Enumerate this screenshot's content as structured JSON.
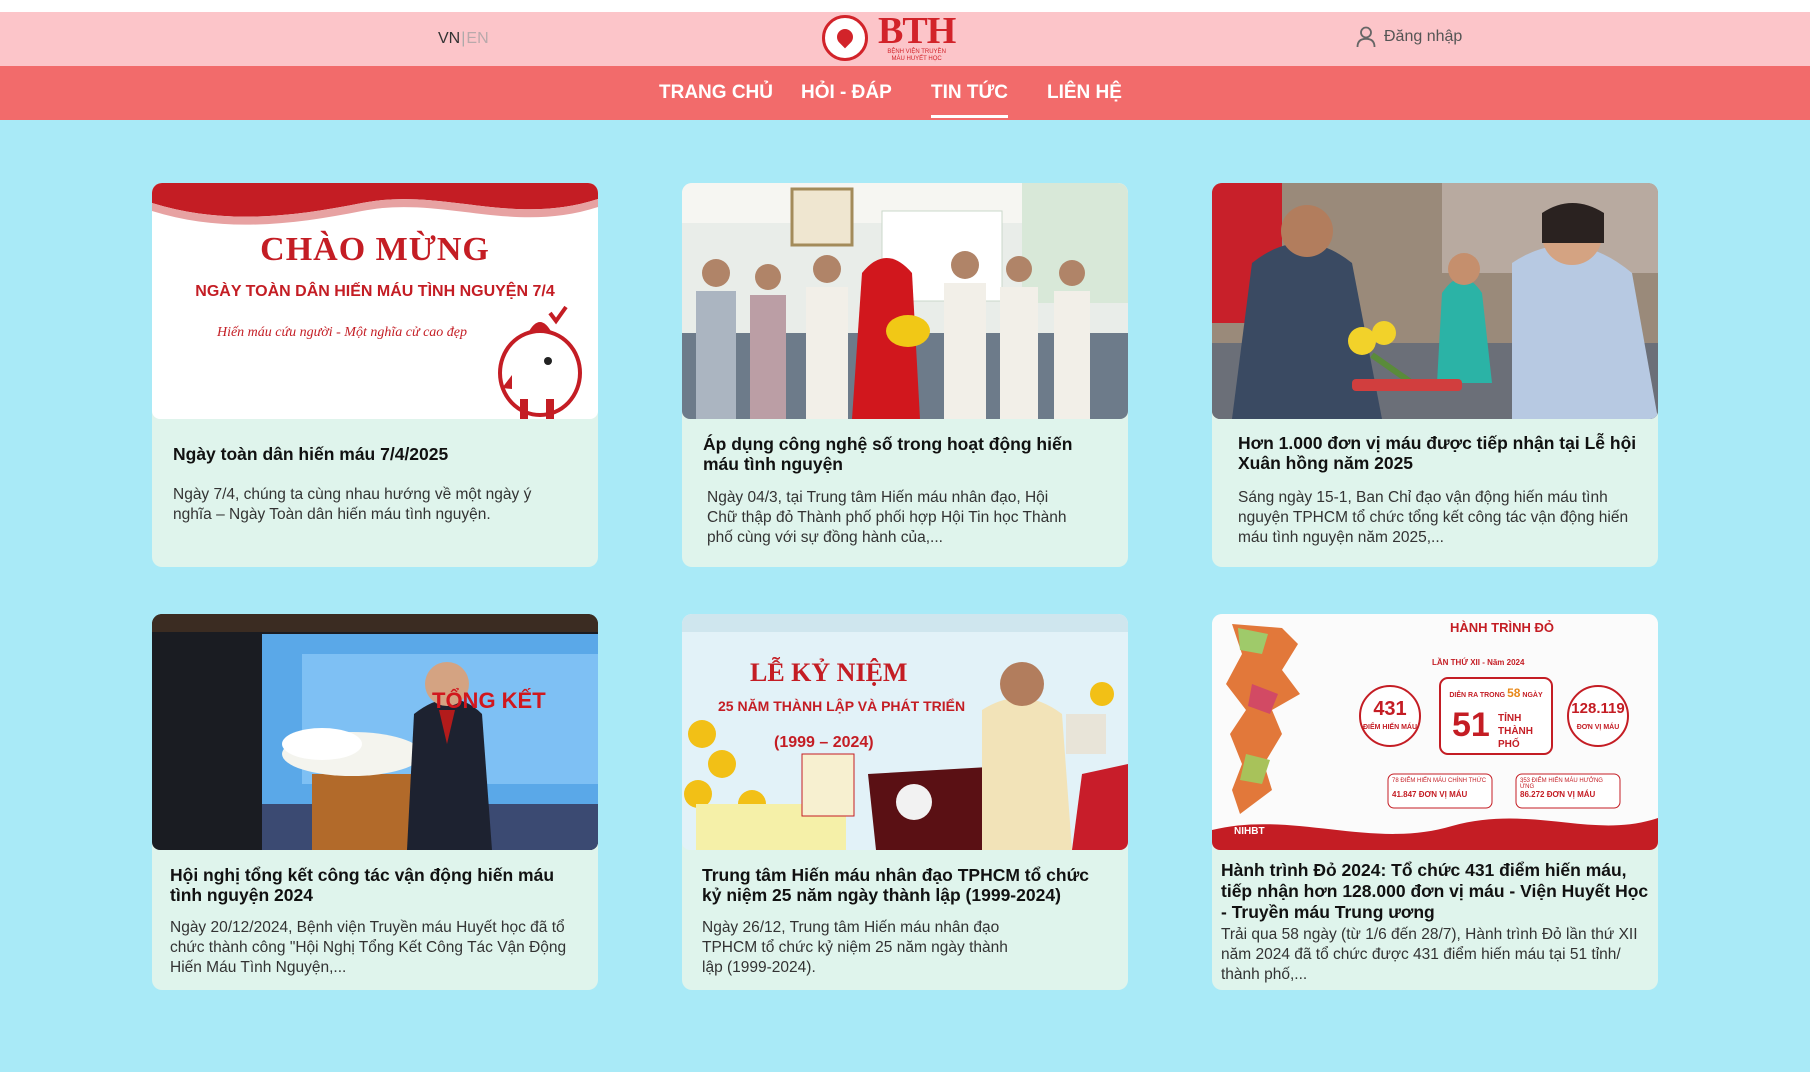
{
  "header": {
    "lang_vn": "VN",
    "lang_sep": "|",
    "lang_en": "EN",
    "logo_text": "BTH",
    "logo_sub": "BỆNH VIỆN TRUYỀN MÁU HUYẾT HỌC",
    "login_label": "Đăng nhập"
  },
  "nav": {
    "items": [
      {
        "label": "TRANG CHỦ"
      },
      {
        "label": "HỎI - ĐÁP"
      },
      {
        "label": "TIN TỨC",
        "active": true
      },
      {
        "label": "LIÊN HỆ"
      }
    ]
  },
  "colors": {
    "page_bg": "#a9eaf7",
    "topbar_bg": "#fcc5c9",
    "navbar_bg": "#f26b6b",
    "card_bg": "#dff4ec",
    "brand_red": "#d2232a"
  },
  "news": [
    {
      "title": "Ngày toàn dân hiến máu 7/4/2025",
      "desc": "Ngày 7/4, chúng ta cùng nhau hướng về một ngày ý nghĩa – Ngày Toàn dân hiến máu tình nguyện.",
      "banner_heading": "CHÀO MỪNG",
      "banner_sub": "NGÀY TOÀN DÂN HIẾN MÁU TÌNH NGUYỆN 7/4",
      "banner_slogan": "Hiến máu cứu người - Một nghĩa cử cao đẹp"
    },
    {
      "title": "Áp dụng công nghệ số trong hoạt động hiến máu tình nguyện",
      "desc": "Ngày 04/3, tại Trung tâm Hiến máu nhân đạo, Hội Chữ thập đỏ Thành phố phối hợp Hội Tin học Thành phố cùng với sự đồng hành của,..."
    },
    {
      "title": "Hơn 1.000 đơn vị máu được tiếp nhận tại Lễ hội Xuân hồng năm 2025",
      "desc": "Sáng ngày 15-1, Ban Chỉ đạo vận động hiến máu tình nguyện TPHCM tổ chức tổng kết công tác vận động hiến máu tình nguyện năm 2025,..."
    },
    {
      "title": "Hội nghị tổng kết công tác vận động hiến máu tình nguyện 2024",
      "desc": "Ngày 20/12/2024, Bệnh viện Truyền máu Huyết học đã tổ chức thành công \"Hội Nghị Tổng Kết Công Tác Vận Động Hiến Máu Tình Nguyện,...",
      "banner_text": "TỔNG KẾT"
    },
    {
      "title": "Trung tâm Hiến máu nhân đạo TPHCM tổ chức kỷ niệm 25 năm ngày thành lập (1999-2024)",
      "desc": "Ngày 26/12, Trung tâm Hiến máu nhân đạo TPHCM tổ chức kỷ niệm 25 năm ngày thành lập (1999-2024).",
      "banner_heading": "LỄ KỶ NIỆM",
      "banner_sub": "25 NĂM THÀNH LẬP VÀ PHÁT TRIỂN",
      "banner_sub2": "(1999 – 2024)"
    },
    {
      "title": "Hành trình Đỏ 2024: Tổ chức 431 điểm hiến máu, tiếp nhận hơn 128.000 đơn vị máu - Viện Huyết Học - Truyền máu Trung ương",
      "desc": "Trải qua 58 ngày (từ 1/6 đến 28/7), Hành trình Đỏ lần thứ XII năm 2024 đã tổ chức được 431 điểm hiến máu tại 51 tỉnh/ thành phố,...",
      "info": {
        "brand": "HÀNH TRÌNH ĐỎ",
        "edition": "LẦN THỨ XII - Năm 2024",
        "points_value": "431",
        "points_label": "ĐIỂM HIẾN MÁU",
        "days_prefix": "DIỄN RA TRONG",
        "days_value": "58",
        "days_suffix": "NGÀY",
        "provinces_value": "51",
        "provinces_label": "TỈNH THÀNH PHỐ",
        "units_value": "128.119",
        "units_label": "ĐƠN VỊ MÁU",
        "stat1": "78 ĐIỂM HIẾN MÁU CHÍNH THỨC",
        "stat1_units": "41.847 ĐƠN VỊ MÁU",
        "stat2": "353 ĐIỂM HIẾN MÁU HƯỞNG ỨNG",
        "stat2_units": "86.272 ĐƠN VỊ MÁU",
        "org": "NIHBT"
      }
    }
  ]
}
